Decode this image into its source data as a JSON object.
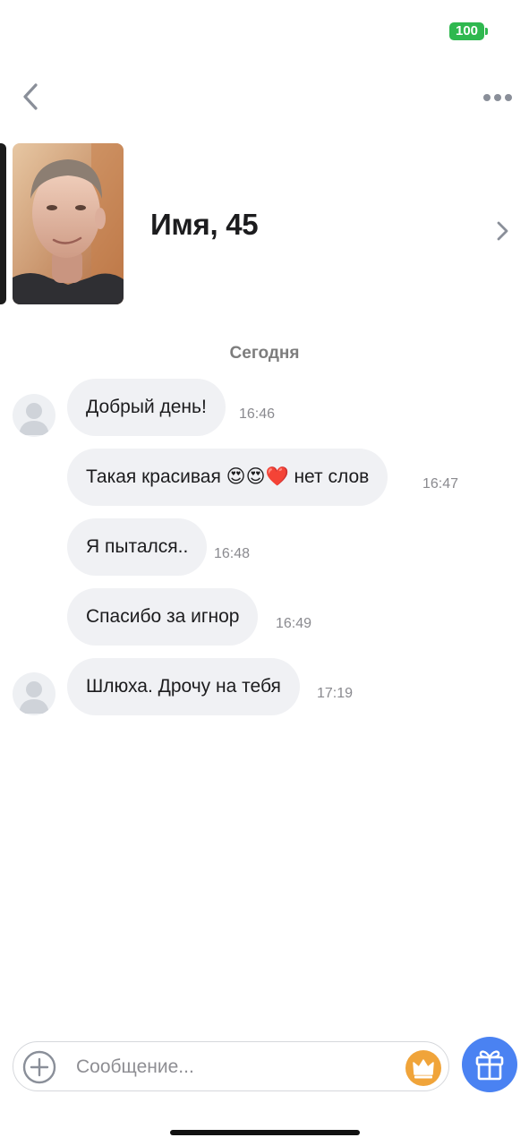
{
  "status_bar": {
    "battery_level": "100",
    "battery_color": "#2fb84f"
  },
  "nav": {
    "back_icon": "chevron-left-icon",
    "more_icon": "more-horizontal-icon"
  },
  "profile": {
    "name_age": "Имя, 45",
    "chevron_icon": "chevron-right-icon"
  },
  "chat": {
    "date_separator": "Сегодня",
    "messages": [
      {
        "text": "Добрый день!",
        "time": "16:46",
        "show_avatar": true
      },
      {
        "text": "Такая красивая 😍😍❤️ нет слов",
        "time": "16:47",
        "show_avatar": false
      },
      {
        "text": "Я пытался..",
        "time": "16:48",
        "show_avatar": false
      },
      {
        "text": "Спасибо за игнор",
        "time": "16:49",
        "show_avatar": false
      },
      {
        "text": "Шлюха. Дрочу на тебя",
        "time": "17:19",
        "show_avatar": true
      }
    ]
  },
  "composer": {
    "placeholder": "Сообщение...",
    "add_icon": "plus-circle-icon",
    "crown_icon": "crown-icon",
    "gift_icon": "gift-icon",
    "accent_color": "#4a82f2",
    "crown_color": "#f0a43a"
  }
}
